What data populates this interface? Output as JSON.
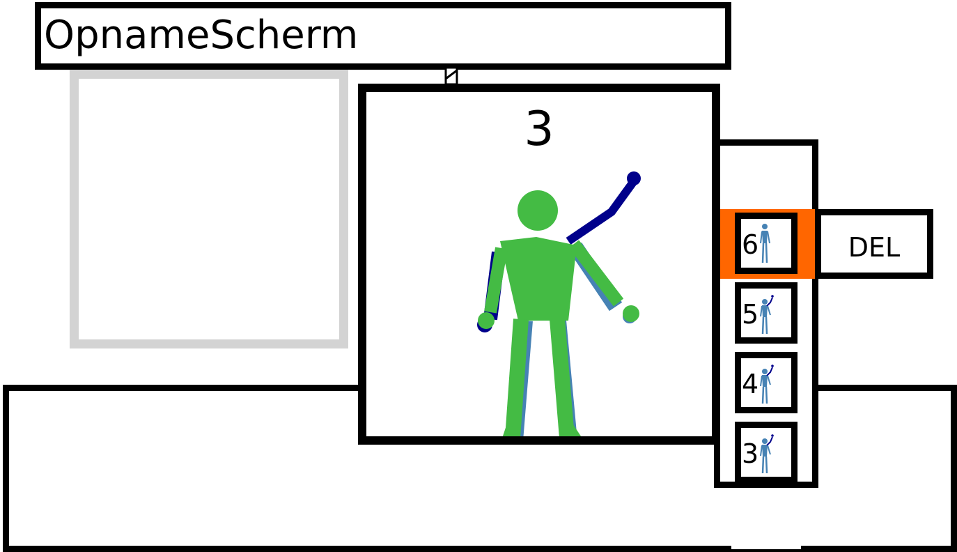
{
  "screen": {
    "title": "OpnameScherm"
  },
  "editor": {
    "frame_number": "3"
  },
  "frame_list": {
    "items": [
      {
        "number": "6",
        "selected": true,
        "pose": "arms-down"
      },
      {
        "number": "5",
        "selected": false,
        "pose": "arm-raised"
      },
      {
        "number": "4",
        "selected": false,
        "pose": "arm-raised"
      },
      {
        "number": "3",
        "selected": false,
        "pose": "arm-raised"
      }
    ]
  },
  "actions": {
    "delete_label": "DEL"
  },
  "colors": {
    "figure_current": "#44bb44",
    "figure_previous_dark": "#00008b",
    "figure_previous_light": "#4682b4",
    "selection": "#ff6600",
    "preview_border": "#d3d3d3"
  }
}
